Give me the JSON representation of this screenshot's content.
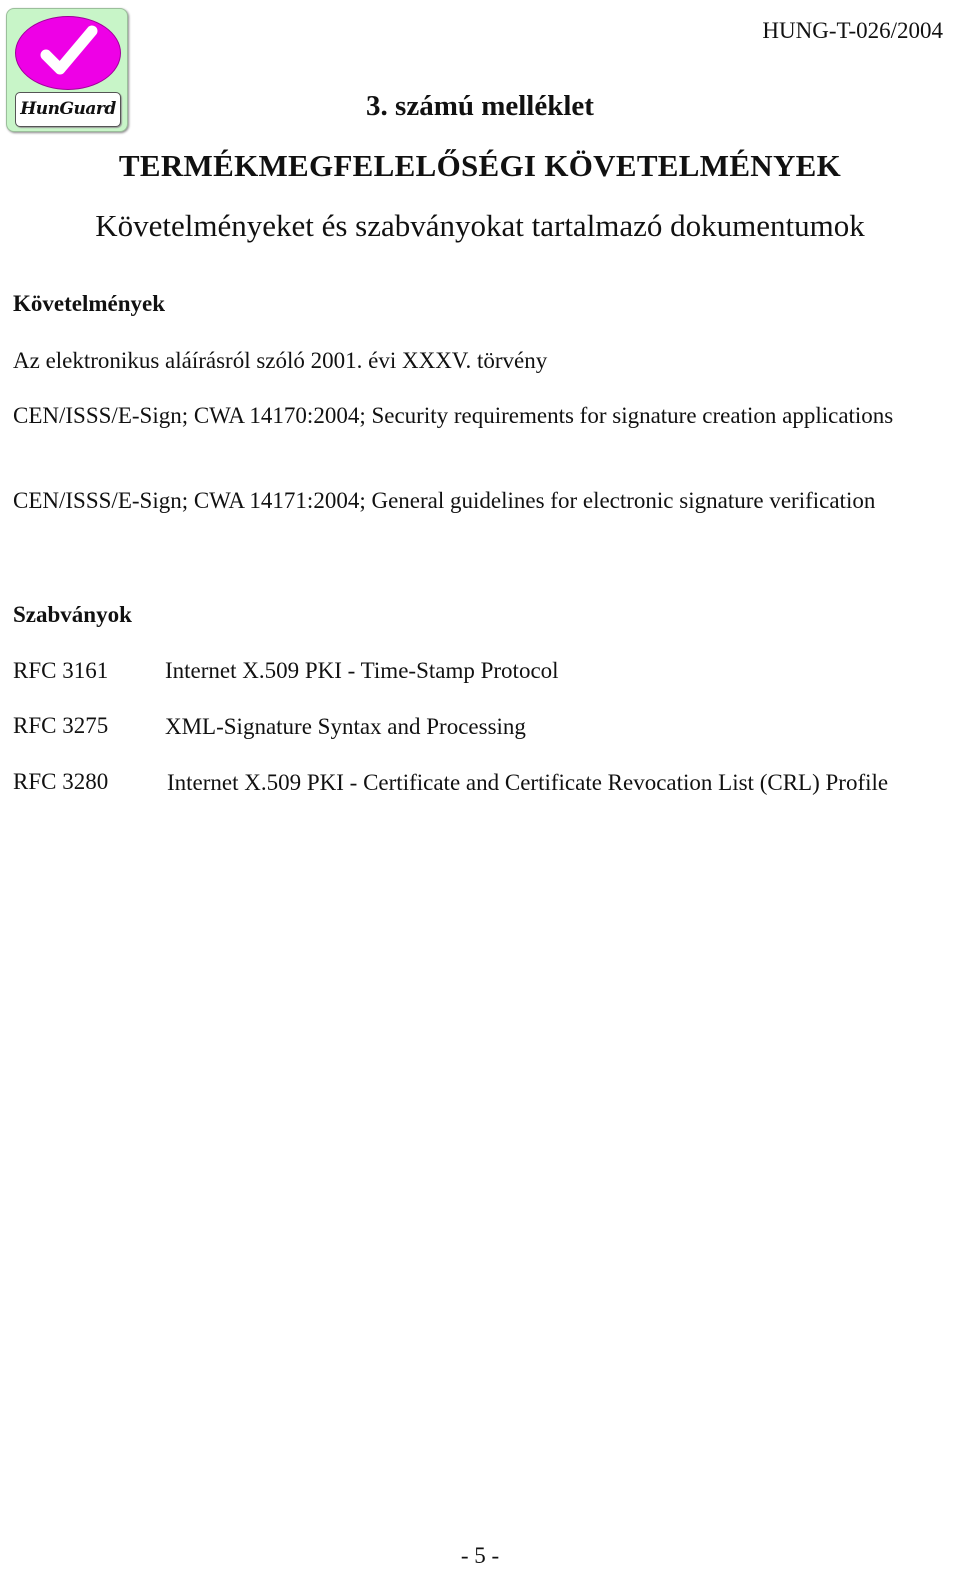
{
  "header": {
    "logo_text": "HunGuard",
    "logo_colors": {
      "background": "#c8f5c8",
      "ellipse": "#ee00e6",
      "check": "#ffffff"
    },
    "document_id": "HUNG-T-026/2004"
  },
  "headings": {
    "annex": "3. számú melléklet",
    "title": "TERMÉKMEGFELELŐSÉGI KÖVETELMÉNYEK",
    "subtitle": "Követelményeket és szabványokat tartalmazó dokumentumok"
  },
  "requirements": {
    "heading": "Követelmények",
    "items": [
      "Az elektronikus aláírásról szóló 2001. évi XXXV. törvény",
      "CEN/ISSS/E-Sign; CWA 14170:2004; Security requirements for signature creation applications",
      "CEN/ISSS/E-Sign; CWA 14171:2004; General guidelines for electronic signature verification"
    ]
  },
  "standards": {
    "heading": "Szabványok",
    "items": [
      {
        "code": "RFC 3161",
        "title": "Internet X.509 PKI - Time-Stamp Protocol"
      },
      {
        "code": "RFC 3275",
        "title": "XML-Signature Syntax and Processing"
      },
      {
        "code": "RFC 3280",
        "title": "Internet X.509 PKI - Certificate and Certificate Revocation List (CRL) Profile"
      }
    ]
  },
  "footer": {
    "page_number": "- 5 -"
  }
}
